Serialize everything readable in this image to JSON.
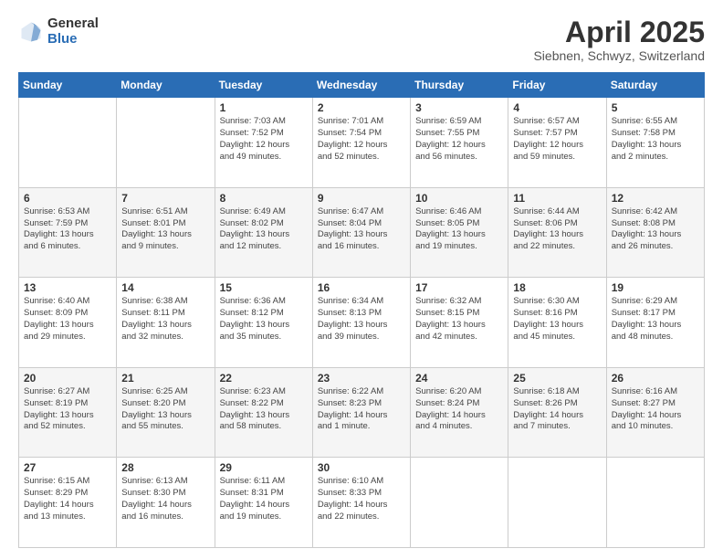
{
  "header": {
    "logo_general": "General",
    "logo_blue": "Blue",
    "month": "April 2025",
    "location": "Siebnen, Schwyz, Switzerland"
  },
  "weekdays": [
    "Sunday",
    "Monday",
    "Tuesday",
    "Wednesday",
    "Thursday",
    "Friday",
    "Saturday"
  ],
  "weeks": [
    [
      {
        "num": "",
        "info": ""
      },
      {
        "num": "",
        "info": ""
      },
      {
        "num": "1",
        "info": "Sunrise: 7:03 AM\nSunset: 7:52 PM\nDaylight: 12 hours\nand 49 minutes."
      },
      {
        "num": "2",
        "info": "Sunrise: 7:01 AM\nSunset: 7:54 PM\nDaylight: 12 hours\nand 52 minutes."
      },
      {
        "num": "3",
        "info": "Sunrise: 6:59 AM\nSunset: 7:55 PM\nDaylight: 12 hours\nand 56 minutes."
      },
      {
        "num": "4",
        "info": "Sunrise: 6:57 AM\nSunset: 7:57 PM\nDaylight: 12 hours\nand 59 minutes."
      },
      {
        "num": "5",
        "info": "Sunrise: 6:55 AM\nSunset: 7:58 PM\nDaylight: 13 hours\nand 2 minutes."
      }
    ],
    [
      {
        "num": "6",
        "info": "Sunrise: 6:53 AM\nSunset: 7:59 PM\nDaylight: 13 hours\nand 6 minutes."
      },
      {
        "num": "7",
        "info": "Sunrise: 6:51 AM\nSunset: 8:01 PM\nDaylight: 13 hours\nand 9 minutes."
      },
      {
        "num": "8",
        "info": "Sunrise: 6:49 AM\nSunset: 8:02 PM\nDaylight: 13 hours\nand 12 minutes."
      },
      {
        "num": "9",
        "info": "Sunrise: 6:47 AM\nSunset: 8:04 PM\nDaylight: 13 hours\nand 16 minutes."
      },
      {
        "num": "10",
        "info": "Sunrise: 6:46 AM\nSunset: 8:05 PM\nDaylight: 13 hours\nand 19 minutes."
      },
      {
        "num": "11",
        "info": "Sunrise: 6:44 AM\nSunset: 8:06 PM\nDaylight: 13 hours\nand 22 minutes."
      },
      {
        "num": "12",
        "info": "Sunrise: 6:42 AM\nSunset: 8:08 PM\nDaylight: 13 hours\nand 26 minutes."
      }
    ],
    [
      {
        "num": "13",
        "info": "Sunrise: 6:40 AM\nSunset: 8:09 PM\nDaylight: 13 hours\nand 29 minutes."
      },
      {
        "num": "14",
        "info": "Sunrise: 6:38 AM\nSunset: 8:11 PM\nDaylight: 13 hours\nand 32 minutes."
      },
      {
        "num": "15",
        "info": "Sunrise: 6:36 AM\nSunset: 8:12 PM\nDaylight: 13 hours\nand 35 minutes."
      },
      {
        "num": "16",
        "info": "Sunrise: 6:34 AM\nSunset: 8:13 PM\nDaylight: 13 hours\nand 39 minutes."
      },
      {
        "num": "17",
        "info": "Sunrise: 6:32 AM\nSunset: 8:15 PM\nDaylight: 13 hours\nand 42 minutes."
      },
      {
        "num": "18",
        "info": "Sunrise: 6:30 AM\nSunset: 8:16 PM\nDaylight: 13 hours\nand 45 minutes."
      },
      {
        "num": "19",
        "info": "Sunrise: 6:29 AM\nSunset: 8:17 PM\nDaylight: 13 hours\nand 48 minutes."
      }
    ],
    [
      {
        "num": "20",
        "info": "Sunrise: 6:27 AM\nSunset: 8:19 PM\nDaylight: 13 hours\nand 52 minutes."
      },
      {
        "num": "21",
        "info": "Sunrise: 6:25 AM\nSunset: 8:20 PM\nDaylight: 13 hours\nand 55 minutes."
      },
      {
        "num": "22",
        "info": "Sunrise: 6:23 AM\nSunset: 8:22 PM\nDaylight: 13 hours\nand 58 minutes."
      },
      {
        "num": "23",
        "info": "Sunrise: 6:22 AM\nSunset: 8:23 PM\nDaylight: 14 hours\nand 1 minute."
      },
      {
        "num": "24",
        "info": "Sunrise: 6:20 AM\nSunset: 8:24 PM\nDaylight: 14 hours\nand 4 minutes."
      },
      {
        "num": "25",
        "info": "Sunrise: 6:18 AM\nSunset: 8:26 PM\nDaylight: 14 hours\nand 7 minutes."
      },
      {
        "num": "26",
        "info": "Sunrise: 6:16 AM\nSunset: 8:27 PM\nDaylight: 14 hours\nand 10 minutes."
      }
    ],
    [
      {
        "num": "27",
        "info": "Sunrise: 6:15 AM\nSunset: 8:29 PM\nDaylight: 14 hours\nand 13 minutes."
      },
      {
        "num": "28",
        "info": "Sunrise: 6:13 AM\nSunset: 8:30 PM\nDaylight: 14 hours\nand 16 minutes."
      },
      {
        "num": "29",
        "info": "Sunrise: 6:11 AM\nSunset: 8:31 PM\nDaylight: 14 hours\nand 19 minutes."
      },
      {
        "num": "30",
        "info": "Sunrise: 6:10 AM\nSunset: 8:33 PM\nDaylight: 14 hours\nand 22 minutes."
      },
      {
        "num": "",
        "info": ""
      },
      {
        "num": "",
        "info": ""
      },
      {
        "num": "",
        "info": ""
      }
    ]
  ]
}
